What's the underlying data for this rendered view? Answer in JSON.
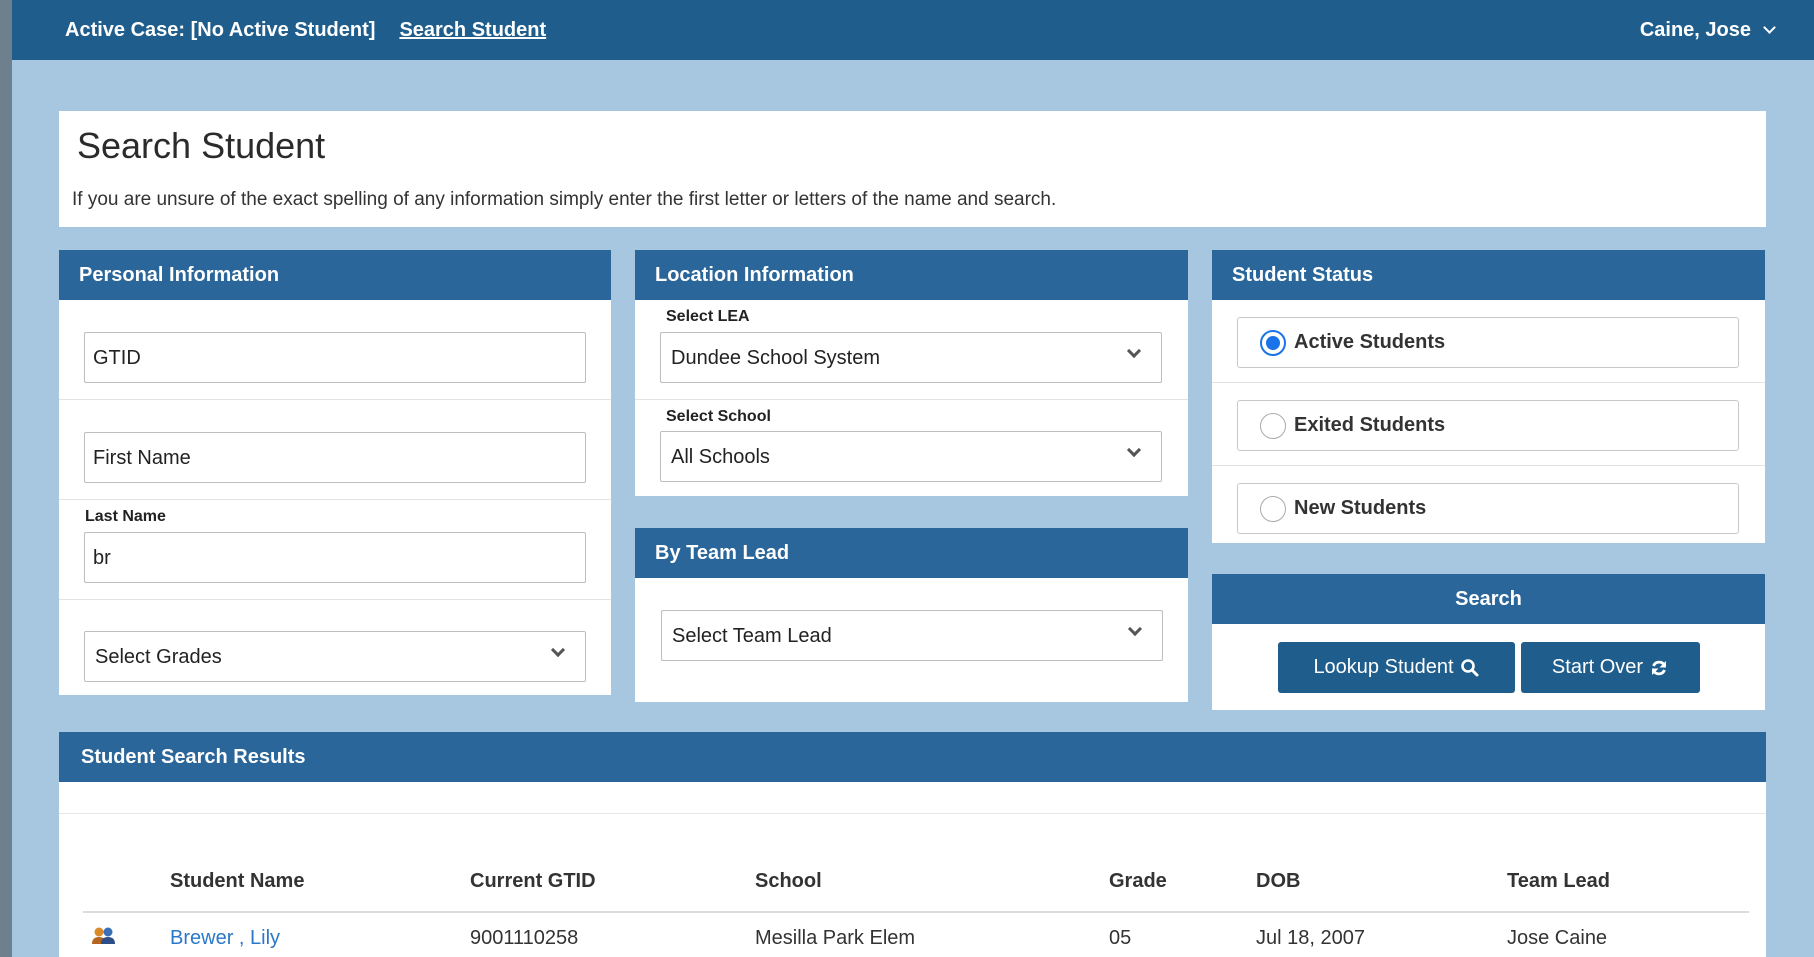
{
  "topbar": {
    "active_case": "Active Case: [No Active Student]",
    "search_link": "Search Student",
    "user_name": "Caine, Jose"
  },
  "header": {
    "title": "Search Student",
    "hint": "If you are unsure of the exact spelling of any information simply enter the first letter or letters of the name and search."
  },
  "personal": {
    "title": "Personal Information",
    "gtid_value": "GTID",
    "first_name_value": "First Name",
    "last_name_label": "Last Name",
    "last_name_value": "br",
    "grades_value": "Select Grades"
  },
  "location": {
    "title": "Location Information",
    "lea_label": "Select LEA",
    "lea_value": "Dundee School System",
    "school_label": "Select School",
    "school_value": "All Schools"
  },
  "team_lead": {
    "title": "By Team Lead",
    "value": "Select Team Lead"
  },
  "status": {
    "title": "Student Status",
    "options": [
      {
        "label": "Active Students",
        "selected": true
      },
      {
        "label": "Exited Students",
        "selected": false
      },
      {
        "label": "New Students",
        "selected": false
      }
    ]
  },
  "search": {
    "title": "Search",
    "lookup_label": "Lookup Student",
    "start_over_label": "Start Over"
  },
  "results": {
    "title": "Student Search Results",
    "columns": [
      "Student Name",
      "Current GTID",
      "School",
      "Grade",
      "DOB",
      "Team Lead"
    ],
    "rows": [
      {
        "name": "Brewer , Lily",
        "gtid": "9001110258",
        "school": "Mesilla Park Elem",
        "grade": "05",
        "dob": "Jul 18, 2007",
        "team_lead": "Jose Caine"
      }
    ]
  },
  "colors": {
    "topbar": "#1f5e8c",
    "panel_header": "#2a6699",
    "page_bg": "#a7c7e0",
    "link": "#2a78c8"
  }
}
